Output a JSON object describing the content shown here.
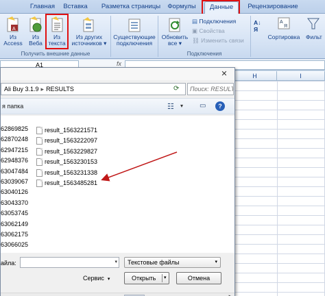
{
  "ribbon": {
    "tabs": [
      "Главная",
      "Вставка",
      "Разметка страницы",
      "Формулы",
      "Данные",
      "Рецензирование"
    ],
    "active_tab": "Данные",
    "groups": {
      "external_data": {
        "label": "Получить внешние данные",
        "buttons": [
          {
            "line1": "Из",
            "line2": "Access"
          },
          {
            "line1": "Из",
            "line2": "Веба"
          },
          {
            "line1": "Из",
            "line2": "текста"
          },
          {
            "line1": "Из других",
            "line2": "источников"
          }
        ]
      },
      "existing_connections": {
        "line1": "Существующие",
        "line2": "подключения"
      },
      "connections": {
        "label": "Подключения",
        "refresh": {
          "line1": "Обновить",
          "line2": "все"
        },
        "items": [
          "Подключения",
          "Свойства",
          "Изменить связи"
        ]
      },
      "sort": {
        "label": "Сортировка"
      },
      "filter": {
        "label": "Фильт"
      }
    }
  },
  "formula_bar": {
    "name_box": "A1",
    "fx": "fx",
    "value": ""
  },
  "sheet": {
    "columns": [
      "H",
      "I"
    ]
  },
  "dialog": {
    "address": {
      "part1": "Ali Buy 3.1.9",
      "sep": "▸",
      "part2": "RESULTS"
    },
    "search_placeholder": "Поиск: RESULTS",
    "new_folder": "я папка",
    "left_numbers": [
      "62869825",
      "62870248",
      "62947215",
      "62948376",
      "63047484",
      "63039067",
      "63040126",
      "63043370",
      "63053745",
      "63062149",
      "63062175",
      "63066025"
    ],
    "files": [
      "result_1563221571",
      "result_1563222097",
      "result_1563229827",
      "result_1563230153",
      "result_1563231338",
      "result_1563485281"
    ],
    "file_name_label": "айла:",
    "file_name_value": "",
    "file_type": "Текстовые файлы",
    "service": "Сервис",
    "open": "Открыть",
    "cancel": "Отмена"
  },
  "colors": {
    "highlight": "#e01010",
    "annotation_arrow": "#c01818"
  }
}
